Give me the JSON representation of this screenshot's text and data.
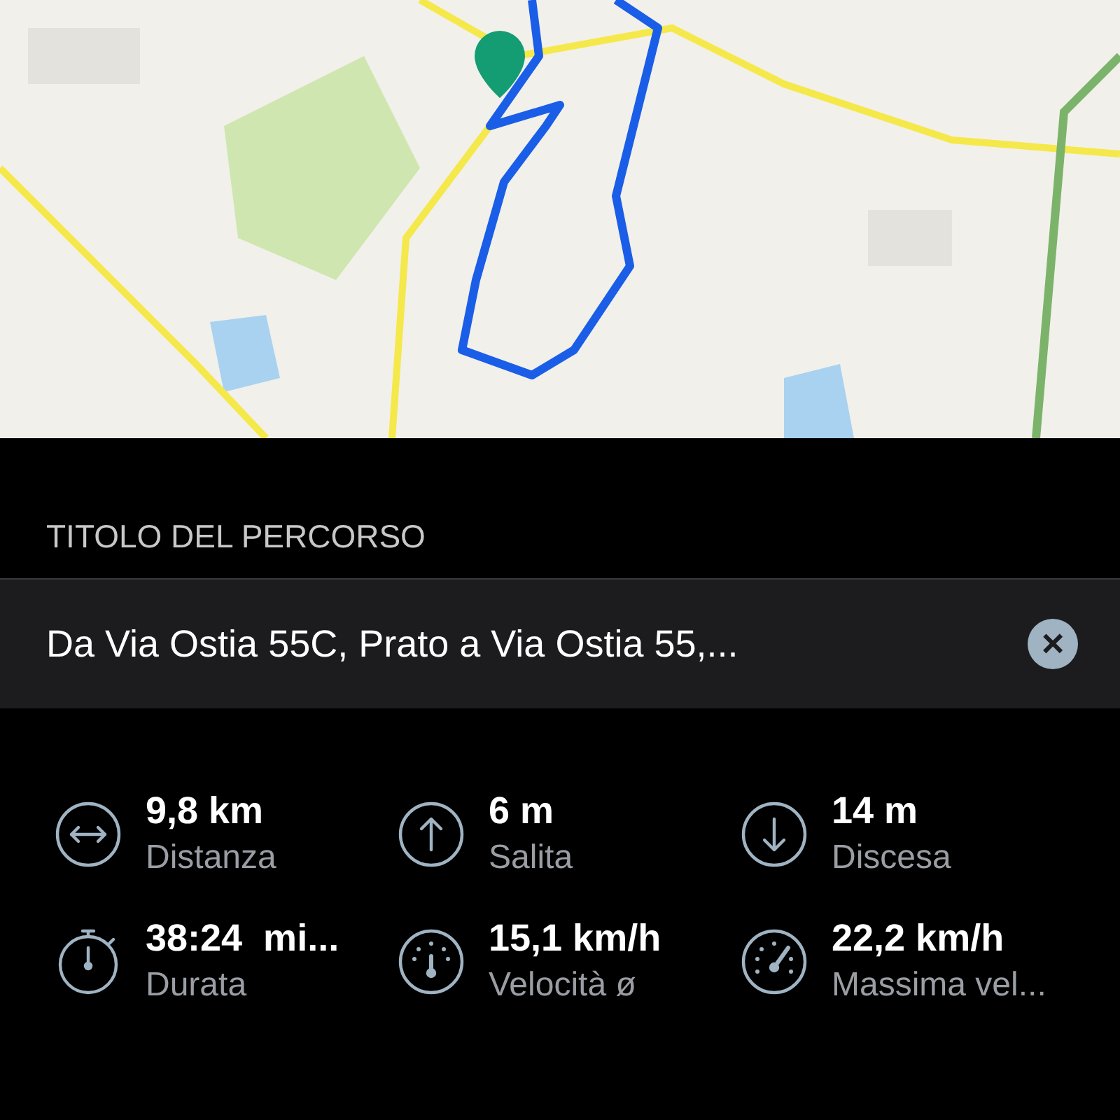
{
  "route_title": {
    "label": "TITOLO DEL PERCORSO",
    "value": "Da Via Ostia 55C, Prato a Via Ostia 55,...",
    "clear": "×"
  },
  "stats": [
    {
      "kind": "distance",
      "value": "9,8 km",
      "label": "Distanza"
    },
    {
      "kind": "ascent",
      "value": "6 m",
      "label": "Salita"
    },
    {
      "kind": "descent",
      "value": "14 m",
      "label": "Discesa"
    },
    {
      "kind": "duration",
      "value": "38:24  mi...",
      "label": "Durata"
    },
    {
      "kind": "avg-speed",
      "value": "15,1 km/h",
      "label": "Velocità ø"
    },
    {
      "kind": "max-speed",
      "value": "22,2 km/h",
      "label": "Massima vel..."
    }
  ]
}
